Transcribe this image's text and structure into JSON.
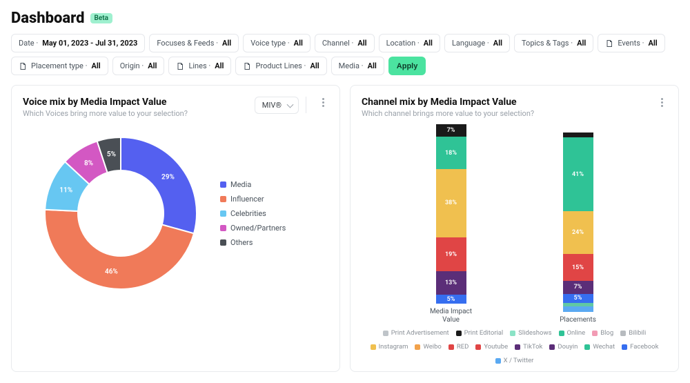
{
  "header": {
    "title": "Dashboard",
    "badge": "Beta"
  },
  "filters": [
    {
      "label": "Date",
      "value": "May 01, 2023 - Jul 31, 2023",
      "icon": null
    },
    {
      "label": "Focuses & Feeds",
      "value": "All",
      "icon": null
    },
    {
      "label": "Voice type",
      "value": "All",
      "icon": null
    },
    {
      "label": "Channel",
      "value": "All",
      "icon": null
    },
    {
      "label": "Location",
      "value": "All",
      "icon": null
    },
    {
      "label": "Language",
      "value": "All",
      "icon": null
    },
    {
      "label": "Topics & Tags",
      "value": "All",
      "icon": null
    },
    {
      "label": "Events",
      "value": "All",
      "icon": "doc"
    },
    {
      "label": "Placement type",
      "value": "All",
      "icon": "doc"
    },
    {
      "label": "Origin",
      "value": "All",
      "icon": null
    },
    {
      "label": "Lines",
      "value": "All",
      "icon": "doc"
    },
    {
      "label": "Product Lines",
      "value": "All",
      "icon": "doc"
    },
    {
      "label": "Media",
      "value": "All",
      "icon": null
    }
  ],
  "apply_label": "Apply",
  "voice_card": {
    "title": "Voice mix by Media Impact Value",
    "subtitle": "Which Voices bring more value to your selection?",
    "selector_value": "MIV®",
    "legend": [
      "Media",
      "Influencer",
      "Celebrities",
      "Owned/Partners",
      "Others"
    ]
  },
  "channel_card": {
    "title": "Channel mix by Media Impact Value",
    "subtitle": "Which channel brings more value to your selection?"
  },
  "colors": {
    "media": "#5460f0",
    "influencer": "#f07a59",
    "celebrities": "#67c7f2",
    "owned": "#d358c3",
    "others": "#4a4f55",
    "print_ad": "#bfc4c9",
    "print_ed": "#1a1a1a",
    "slideshows": "#8be3c6",
    "online": "#2fc396",
    "blog": "#f29bb4",
    "bilibili": "#b7bbbf",
    "instagram": "#f0c04f",
    "weibo": "#f2a24b",
    "red": "#e04545",
    "youtube": "#e04545",
    "tiktok": "#5b2e78",
    "douyin": "#5b2e78",
    "wechat": "#2fc396",
    "facebook": "#366ef0",
    "x": "#5aa9f2"
  },
  "chart_data": [
    {
      "type": "pie",
      "title": "Voice mix by Media Impact Value",
      "series": [
        {
          "name": "Media",
          "value": 29,
          "color": "#5460f0"
        },
        {
          "name": "Influencer",
          "value": 46,
          "color": "#f07a59"
        },
        {
          "name": "Celebrities",
          "value": 11,
          "color": "#67c7f2"
        },
        {
          "name": "Owned/Partners",
          "value": 8,
          "color": "#d358c3"
        },
        {
          "name": "Others",
          "value": 5,
          "color": "#4a4f55"
        }
      ],
      "unit": "%"
    },
    {
      "type": "bar",
      "stacked": true,
      "title": "Channel mix by Media Impact Value",
      "categories": [
        "Media Impact Value",
        "Placements"
      ],
      "unit": "%",
      "series": [
        {
          "name": "Print Editorial",
          "color": "#1a1a1a",
          "values": [
            7,
            3
          ]
        },
        {
          "name": "Online",
          "color": "#2fc396",
          "values": [
            18,
            41
          ]
        },
        {
          "name": "Instagram",
          "color": "#f0c04f",
          "values": [
            38,
            24
          ]
        },
        {
          "name": "Youtube",
          "color": "#e04545",
          "values": [
            19,
            15
          ]
        },
        {
          "name": "TikTok",
          "color": "#5b2e78",
          "values": [
            13,
            7
          ]
        },
        {
          "name": "Facebook",
          "color": "#366ef0",
          "values": [
            5,
            5
          ]
        },
        {
          "name": "Wechat",
          "color": "#61c8a4",
          "values": [
            0,
            2
          ]
        },
        {
          "name": "X / Twitter",
          "color": "#5aa9f2",
          "values": [
            0,
            3
          ]
        }
      ],
      "legend_full": [
        "Print Advertisement",
        "Print Editorial",
        "Slideshows",
        "Online",
        "Blog",
        "Bilibili",
        "Instagram",
        "Weibo",
        "RED",
        "Youtube",
        "TikTok",
        "Douyin",
        "Wechat",
        "Facebook",
        "X / Twitter"
      ],
      "legend_colors": [
        "#bfc4c9",
        "#1a1a1a",
        "#8be3c6",
        "#2fc396",
        "#f29bb4",
        "#b7bbbf",
        "#f0c04f",
        "#f2a24b",
        "#e04545",
        "#e04545",
        "#5b2e78",
        "#5b2e78",
        "#2fc396",
        "#366ef0",
        "#5aa9f2"
      ]
    }
  ]
}
